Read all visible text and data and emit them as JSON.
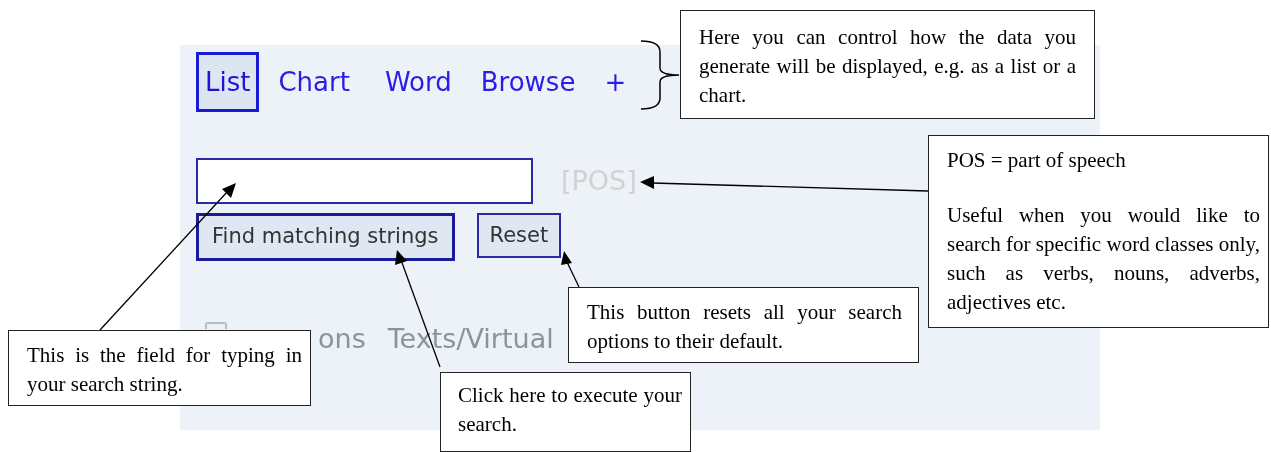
{
  "tabs": [
    {
      "label": "List",
      "selected": true
    },
    {
      "label": "Chart",
      "selected": false
    },
    {
      "label": "Word",
      "selected": false
    },
    {
      "label": "Browse",
      "selected": false
    },
    {
      "label": "+",
      "selected": false
    }
  ],
  "pos_label": "[POS]",
  "buttons": [
    {
      "label": "Find matching strings",
      "default": true
    },
    {
      "label": "Reset",
      "default": false
    }
  ],
  "options_checkbox": {
    "checked": false
  },
  "options_row": [
    "ons",
    "Texts/Virtual"
  ],
  "callouts": [
    {
      "paragraphs": [
        "Here you can control how the data you generate will be displayed, e.g. as a list or a chart."
      ]
    },
    {
      "paragraphs": [
        "POS = part of speech",
        "Useful when you would like to search for specific word classes only, such as verbs, nouns, adverbs, adjectives etc."
      ]
    },
    {
      "paragraphs": [
        "This button resets all your search options to their default."
      ]
    },
    {
      "paragraphs": [
        "This is the field for typing in your search string."
      ]
    },
    {
      "paragraphs": [
        "Click here to execute your search."
      ]
    }
  ]
}
